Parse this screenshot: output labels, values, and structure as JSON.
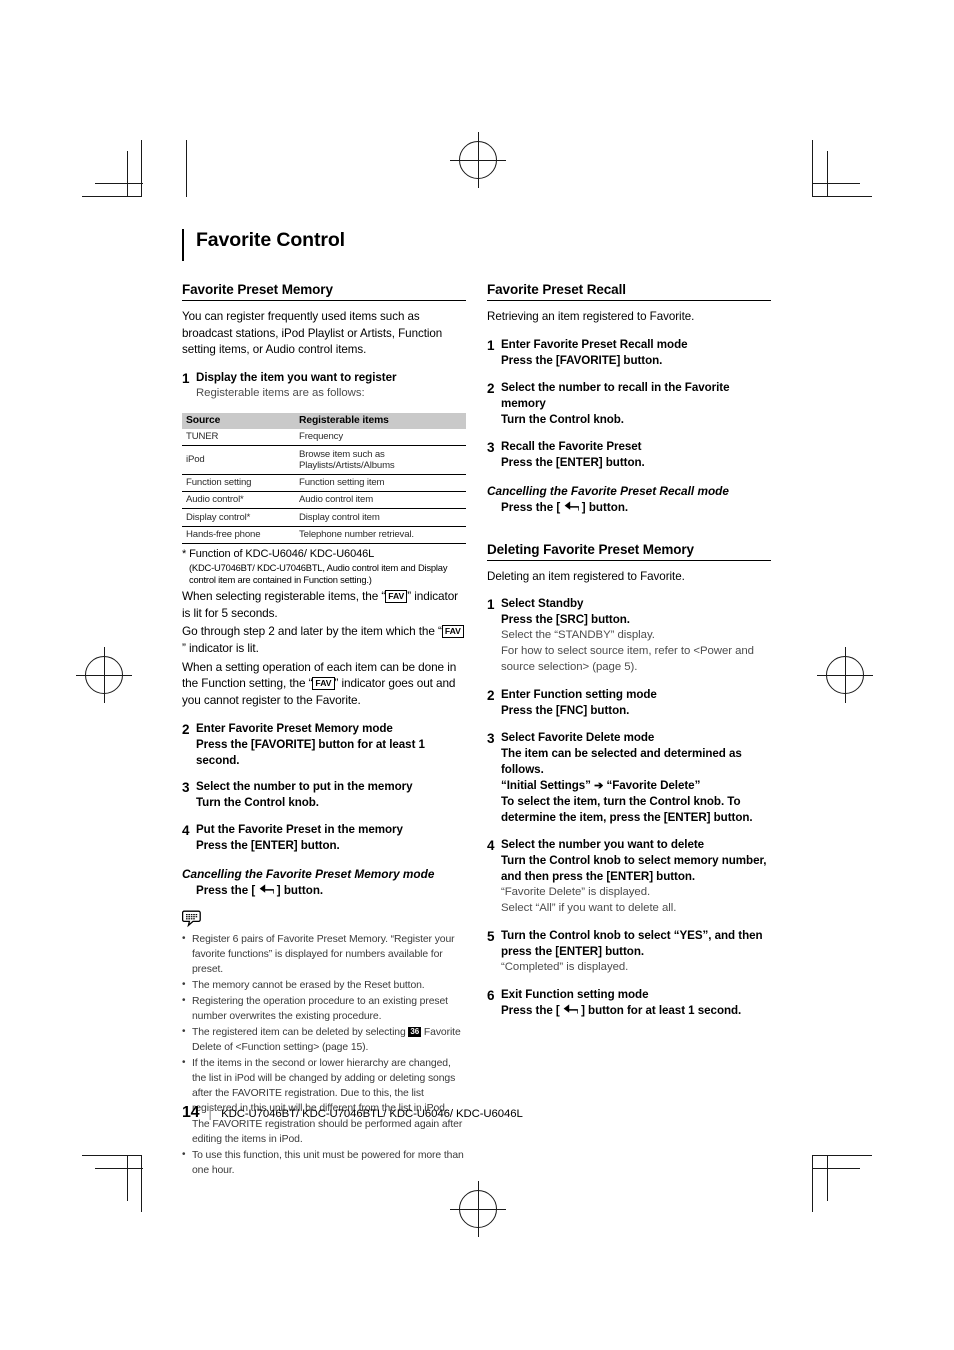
{
  "chapter": {
    "title": "Favorite Control"
  },
  "left": {
    "section1": {
      "heading": "Favorite Preset Memory",
      "intro": "You can register frequently used items such as broadcast stations, iPod Playlist or Artists, Function setting items, or Audio control items.",
      "step1": {
        "num": "1",
        "title": "Display the item you want to register",
        "sub": "Registerable items are as follows:"
      },
      "table": {
        "headers": [
          "Source",
          "Registerable items"
        ],
        "rows": [
          [
            "TUNER",
            "Frequency"
          ],
          [
            "iPod",
            "Browse item such as Playlists/Artists/Albums"
          ],
          [
            "Function setting",
            "Function setting item"
          ],
          [
            "Audio control*",
            "Audio control item"
          ],
          [
            "Display control*",
            "Display control item"
          ],
          [
            "Hands-free phone",
            "Telephone number retrieval."
          ]
        ]
      },
      "footnote_main": "* Function of KDC-U6046/ KDC-U6046L",
      "footnote_sub": "(KDC-U7046BT/ KDC-U7046BTL, Audio control item and Display control item are contained in Function setting.)",
      "para1_a": "When selecting registerable items, the “",
      "fav_label": "FAV",
      "para1_b": "” indicator is lit for 5 seconds.",
      "para2_a": "Go through step 2 and later by the item which the “",
      "para2_b": "” indicator is lit.",
      "para3_a": "When a setting operation of each item can be done in the Function setting, the “",
      "para3_b": "” indicator goes out and you cannot register to the Favorite.",
      "step2": {
        "num": "2",
        "title": "Enter Favorite Preset Memory mode",
        "bold": "Press the [FAVORITE] button for at least 1 second."
      },
      "step3": {
        "num": "3",
        "title": "Select the number to put in the memory",
        "bold": "Turn the Control knob."
      },
      "step4": {
        "num": "4",
        "title": "Put the Favorite Preset in the memory",
        "bold": "Press the [ENTER] button."
      },
      "cancel": {
        "heading": "Cancelling the Favorite Preset Memory mode",
        "before": "Press the [",
        "after": "] button."
      },
      "notes": [
        "Register 6 pairs of Favorite Preset Memory. “Register your favorite functions” is displayed for numbers available for preset.",
        "The memory cannot be erased by the Reset button.",
        "Registering the operation procedure to an existing preset number overwrites the existing procedure.",
        "If the items in the second or lower hierarchy are changed, the list in iPod will be changed by adding or deleting songs after the FAVORITE registration. Due to this, the list registered in this unit will be different from the list in iPod. The FAVORITE registration should be performed again after editing the items in iPod.",
        "To use this function, this unit must be powered for more than one hour."
      ],
      "note_badge": {
        "before": "The registered item can be deleted by selecting ",
        "badge": "36",
        "after": " Favorite Delete of <Function setting> (page 15)."
      }
    }
  },
  "right": {
    "section2": {
      "heading": "Favorite Preset Recall",
      "intro": "Retrieving an item registered to Favorite.",
      "step1": {
        "num": "1",
        "title": "Enter Favorite Preset Recall mode",
        "bold": "Press the [FAVORITE] button."
      },
      "step2": {
        "num": "2",
        "title": "Select the number to recall in the Favorite memory",
        "bold": "Turn the Control knob."
      },
      "step3": {
        "num": "3",
        "title": "Recall the Favorite Preset",
        "bold": "Press the [ENTER] button."
      },
      "cancel": {
        "heading": "Cancelling the Favorite Preset Recall mode",
        "before": "Press the [",
        "after": "] button."
      }
    },
    "section3": {
      "heading": "Deleting Favorite Preset Memory",
      "intro": "Deleting an item registered to Favorite.",
      "step1": {
        "num": "1",
        "title": "Select Standby",
        "bold": "Press the [SRC] button.",
        "sub1": "Select the “STANDBY” display.",
        "sub2": "For how to select source item, refer to <Power and source selection> (page 5)."
      },
      "step2": {
        "num": "2",
        "title": "Enter Function setting mode",
        "bold": "Press the [FNC] button."
      },
      "step3": {
        "num": "3",
        "title": "Select Favorite Delete mode",
        "bold1": "The item can be selected and determined as follows.",
        "path_a": "“Initial Settings”",
        "path_arrow": "➔",
        "path_b": "“Favorite Delete”",
        "bold2": "To select the item, turn the Control knob. To determine the item, press the [ENTER] button."
      },
      "step4": {
        "num": "4",
        "title": "Select the number you want to delete",
        "bold": "Turn the Control knob to select memory number, and then press the [ENTER] button.",
        "sub1": "“Favorite Delete” is displayed.",
        "sub2": "Select “All” if you want to delete all."
      },
      "step5": {
        "num": "5",
        "title": "Turn the Control knob to select “YES”, and then press the [ENTER] button.",
        "sub1": "“Completed” is displayed."
      },
      "step6": {
        "num": "6",
        "title": "Exit Function setting mode",
        "before": "Press the [",
        "after": "] button for at least 1 second."
      }
    }
  },
  "footer": {
    "page": "14",
    "separator": "|",
    "models": "KDC-U7046BT/ KDC-U7046BTL/ KDC-U6046/ KDC-U6046L"
  }
}
